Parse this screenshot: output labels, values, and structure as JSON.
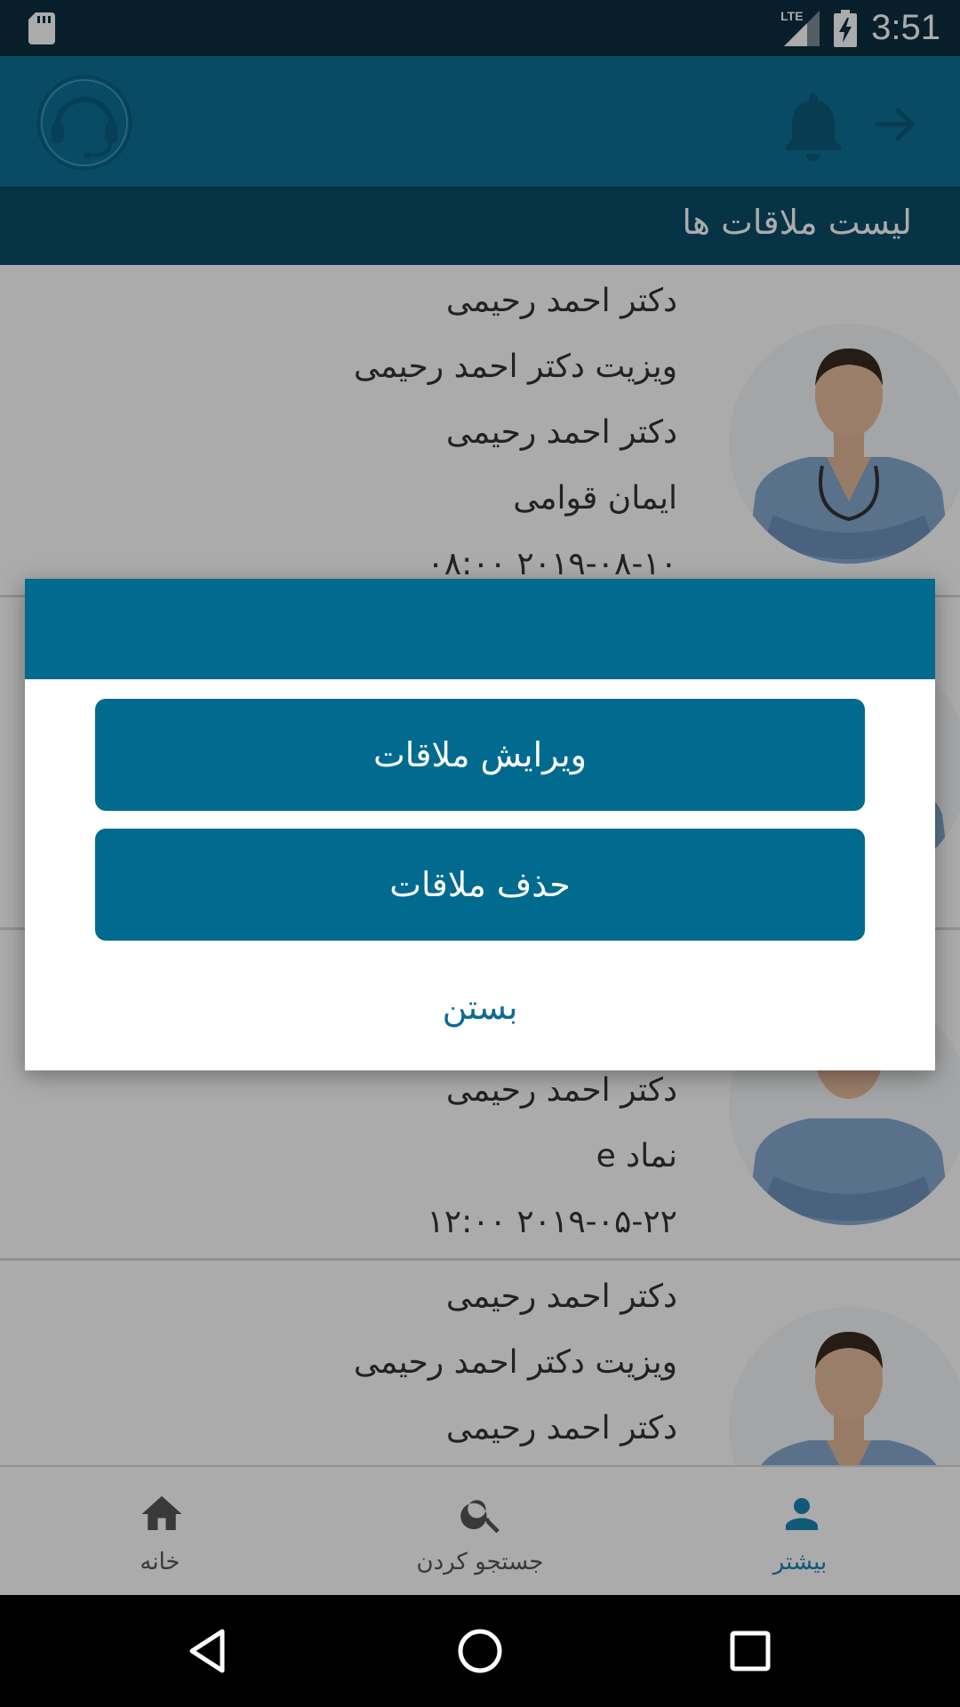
{
  "status_bar": {
    "time": "3:51",
    "network": "LTE"
  },
  "list_header": {
    "title": "لیست ملاقات ها"
  },
  "cards": [
    {
      "lines": [
        "دکتر احمد رحیمی",
        "ویزیت دکتر احمد رحیمی",
        "دکتر احمد رحیمی",
        "ایمان قوامی",
        "۲۰۱۹-۰۸-۱۰ ۰۸:۰۰"
      ]
    },
    {
      "lines": [
        "دکتر احمد رحیمی",
        "نماد e",
        "۲۰۱۹-۰۵-۲۲ ۱۲:۰۰"
      ]
    },
    {
      "lines": [
        "دکتر احمد رحیمی",
        "ویزیت دکتر احمد رحیمی",
        "دکتر احمد رحیمی"
      ]
    }
  ],
  "dialog": {
    "edit_label": "ویرایش ملاقات",
    "delete_label": "حذف ملاقات",
    "close_label": "بستن"
  },
  "bottom_nav": {
    "items": [
      {
        "label": "خانه",
        "icon": "home-icon"
      },
      {
        "label": "جستجو کردن",
        "icon": "search-icon"
      },
      {
        "label": "بیشتر",
        "icon": "person-icon",
        "active": true
      }
    ]
  },
  "colors": {
    "app_bar": "#0e7196",
    "header": "#0b4d6b",
    "primary": "#006a8f",
    "active_nav": "#1a85b5"
  }
}
